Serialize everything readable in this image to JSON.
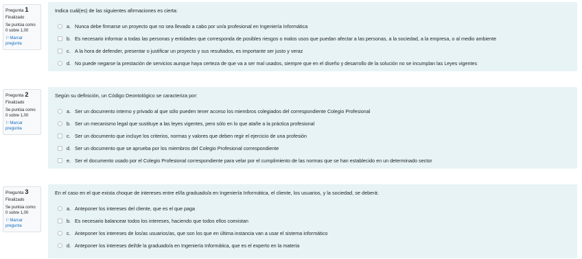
{
  "questions": [
    {
      "info": {
        "label": "Pregunta ",
        "number": "1",
        "state": "Finalizado",
        "grade": "Se puntúa como 0 sobre 1,00",
        "flag": "Marcar pregunta"
      },
      "text": "Indica cuál(es) de las siguientes afirmaciones es cierta:",
      "answers": [
        {
          "letter": "a.",
          "text": "Nunca debe firmarse un proyecto que no sea llevado a cabo por un/a profesional en Ingeniería Informática",
          "type": "radio"
        },
        {
          "letter": "b.",
          "text": "Es necesario informar a todas las personas y entidades que corresponda de posibles riesgos o malos usos que puedan afectar a las personas, a la sociedad, a la empresa, o al medio ambiente",
          "type": "check"
        },
        {
          "letter": "c.",
          "text": "A la hora de defender, presentar o justificar un proyecto y sus resultados, es importante ser justo y veraz",
          "type": "check"
        },
        {
          "letter": "d.",
          "text": "No puede negarse la prestación de servicios aunque haya certeza de que va a ser mal usados, siempre que en el diseño y desarrollo de la solución no se incumplan las Leyes vigentes",
          "type": "radio"
        }
      ]
    },
    {
      "info": {
        "label": "Pregunta ",
        "number": "2",
        "state": "Finalizado",
        "grade": "Se puntúa como 0 sobre 1,00",
        "flag": "Marcar pregunta"
      },
      "text": "Según su definición, un Código Deontológico se caracteriza por:",
      "answers": [
        {
          "letter": "a.",
          "text": "Ser un documento interno y privado al que sólo pueden tener acceso los miembros colegiados del correspondiente Colegio Profesional",
          "type": "radio"
        },
        {
          "letter": "b.",
          "text": "Ser un mecanismo legal que sustituye a las leyes vigentes, pero sólo en lo que atañe a la práctica profesional",
          "type": "radio"
        },
        {
          "letter": "c.",
          "text": "Ser un documento que incluye los criterios, normas y valores que deben regir el ejercicio de una profesión",
          "type": "check"
        },
        {
          "letter": "d.",
          "text": "Ser un documento que se aprueba por los miembros del Colegio Profesional correspondiente",
          "type": "check"
        },
        {
          "letter": "e.",
          "text": "Ser el documento usado por el Colegio Profesional correspondiente para velar por el cumplimiento de las normas que se han establecido en un determinado sector",
          "type": "check"
        }
      ]
    },
    {
      "info": {
        "label": "Pregunta ",
        "number": "3",
        "state": "Finalizado",
        "grade": "Se puntúa como 0 sobre 1,00",
        "flag": "Marcar pregunta"
      },
      "text": "En el caso en el que exista choque de intereses entre el/la graduado/a en Ingeniería Informática, el cliente, los usuarios, y la sociedad, se deberá:",
      "answers": [
        {
          "letter": "a.",
          "text": "Anteponer los intereses del cliente, que es el que paga",
          "type": "radio"
        },
        {
          "letter": "b.",
          "text": "Es necesario balancear todos los intereses, haciendo que todos ellos coexistan",
          "type": "check"
        },
        {
          "letter": "c.",
          "text": "Anteponer los intereses de los/as usuarios/as, que son los que en última instancia van a usar el sistema informático",
          "type": "radio"
        },
        {
          "letter": "d.",
          "text": "Anteponer los intereses del/de la graduado/a en Ingeniería Informática, que es el experto en la materia",
          "type": "radio"
        }
      ]
    }
  ]
}
